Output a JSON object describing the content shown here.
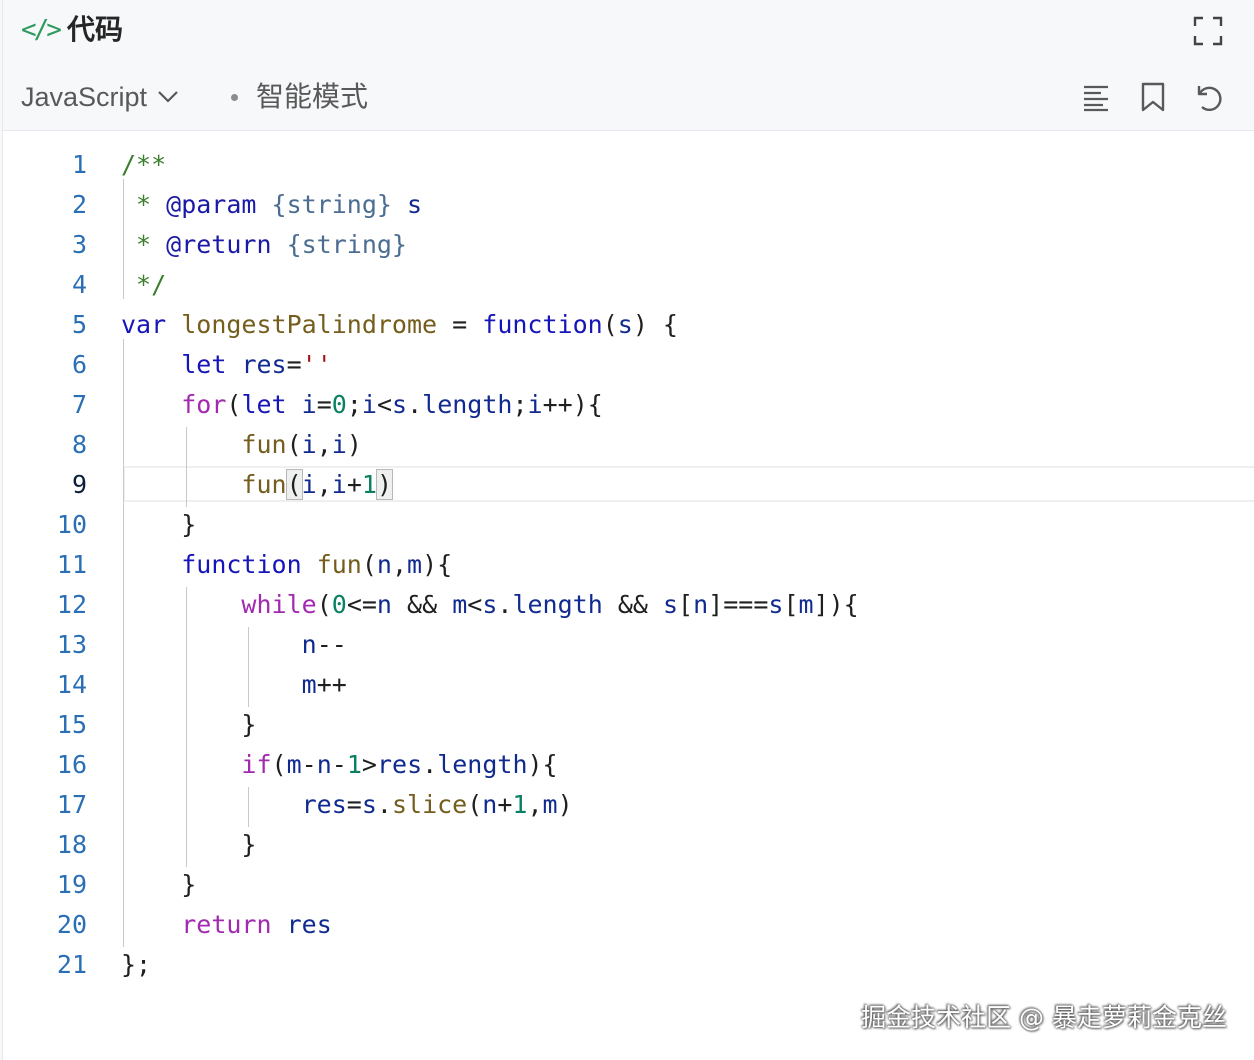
{
  "header": {
    "icon": "code-icon",
    "title": "代码",
    "actions": [
      "fullscreen-icon"
    ]
  },
  "toolbar": {
    "language": "JavaScript",
    "mode": "智能模式",
    "tools": [
      "format-icon",
      "bookmark-icon",
      "undo-icon"
    ]
  },
  "editor": {
    "current_line": 9,
    "lines": [
      {
        "n": "1"
      },
      {
        "n": "2"
      },
      {
        "n": "3"
      },
      {
        "n": "4"
      },
      {
        "n": "5"
      },
      {
        "n": "6"
      },
      {
        "n": "7"
      },
      {
        "n": "8"
      },
      {
        "n": "9"
      },
      {
        "n": "10"
      },
      {
        "n": "11"
      },
      {
        "n": "12"
      },
      {
        "n": "13"
      },
      {
        "n": "14"
      },
      {
        "n": "15"
      },
      {
        "n": "16"
      },
      {
        "n": "17"
      },
      {
        "n": "18"
      },
      {
        "n": "19"
      },
      {
        "n": "20"
      },
      {
        "n": "21"
      }
    ],
    "code": [
      "/**",
      " * @param {string} s",
      " * @return {string}",
      " */",
      "var longestPalindrome = function(s) {",
      "    let res=''",
      "    for(let i=0;i<s.length;i++){",
      "        fun(i,i)",
      "        fun(i,i+1)",
      "    }",
      "    function fun(n,m){",
      "        while(0<=n && m<s.length && s[n]===s[m]){",
      "            n--",
      "            m++",
      "        }",
      "        if(m-n-1>res.length){",
      "            res=s.slice(n+1,m)",
      "        }",
      "    }",
      "    return res",
      "};"
    ]
  },
  "watermark": "掘金技术社区 @ 暴走萝莉金克丝"
}
